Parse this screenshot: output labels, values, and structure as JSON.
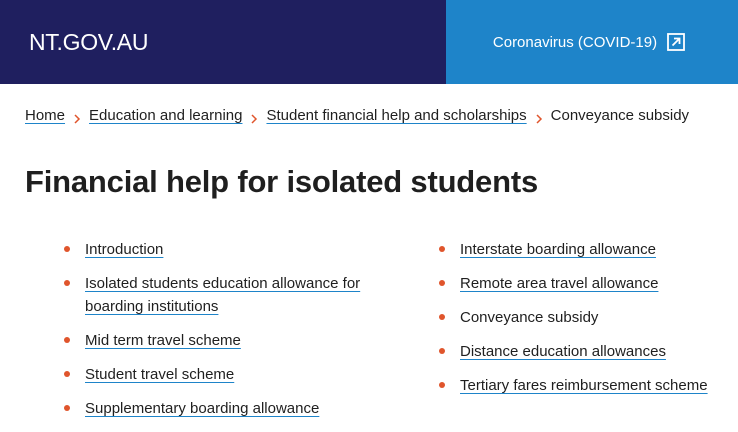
{
  "header": {
    "site_name": "NT.GOV.AU",
    "covid_link": "Coronavirus (COVID-19)",
    "covid_icon": "external-link-icon"
  },
  "breadcrumb": {
    "items": [
      "Home",
      "Education and learning",
      "Student financial help and scholarships"
    ],
    "current": "Conveyance subsidy"
  },
  "page": {
    "title": "Financial help for isolated students"
  },
  "nav": {
    "left": [
      "Introduction",
      "Isolated students education allowance for boarding institutions",
      "Mid term travel scheme",
      "Student travel scheme",
      "Supplementary boarding allowance"
    ],
    "right": [
      "Interstate boarding allowance",
      "Remote area travel allowance",
      "Conveyance subsidy",
      "Distance education allowances",
      "Tertiary fares reimbursement scheme"
    ]
  },
  "colors": {
    "header_navy": "#1f1f5f",
    "header_blue": "#1e84c9",
    "bullet": "#e0552c"
  }
}
